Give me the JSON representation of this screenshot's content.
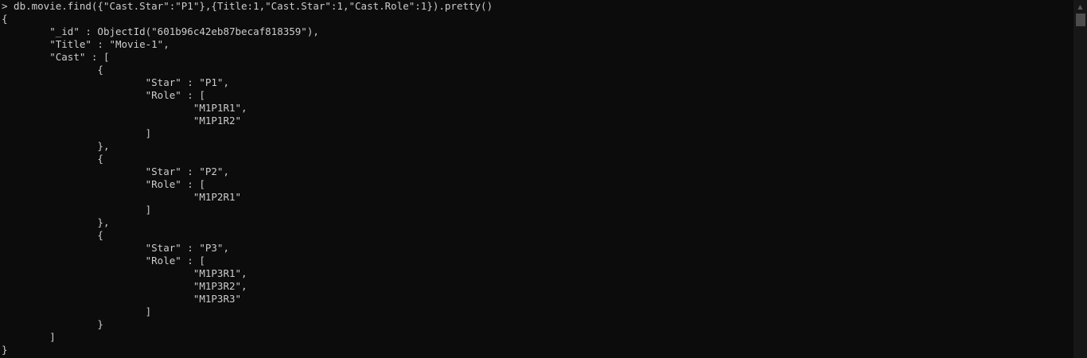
{
  "console": {
    "lines": [
      "> db.movie.find({\"Cast.Star\":\"P1\"},{Title:1,\"Cast.Star\":1,\"Cast.Role\":1}).pretty()",
      "{",
      "\t\"_id\" : ObjectId(\"601b96c42eb87becaf818359\"),",
      "\t\"Title\" : \"Movie-1\",",
      "\t\"Cast\" : [",
      "\t\t{",
      "\t\t\t\"Star\" : \"P1\",",
      "\t\t\t\"Role\" : [",
      "\t\t\t\t\"M1P1R1\",",
      "\t\t\t\t\"M1P1R2\"",
      "\t\t\t]",
      "\t\t},",
      "\t\t{",
      "\t\t\t\"Star\" : \"P2\",",
      "\t\t\t\"Role\" : [",
      "\t\t\t\t\"M1P2R1\"",
      "\t\t\t]",
      "\t\t},",
      "\t\t{",
      "\t\t\t\"Star\" : \"P3\",",
      "\t\t\t\"Role\" : [",
      "\t\t\t\t\"M1P3R1\",",
      "\t\t\t\t\"M1P3R2\",",
      "\t\t\t\t\"M1P3R3\"",
      "\t\t\t]",
      "\t\t}",
      "\t]",
      "}"
    ]
  },
  "scrollbar": {
    "up_icon": "scroll-up-arrow-icon"
  },
  "colors": {
    "background": "#0c0c0c",
    "text": "#cccccc",
    "scrollbar_track": "#171717",
    "scrollbar_thumb": "#4d4d4d"
  }
}
